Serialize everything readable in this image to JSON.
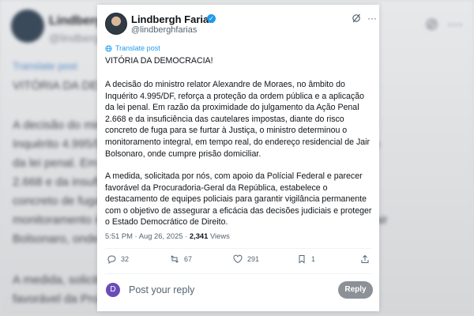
{
  "author": {
    "display_name": "Lindbergh Farias",
    "handle": "@lindberghfarias",
    "verified": true
  },
  "translate_label": "Translate post",
  "post": {
    "headline": "VITÓRIA DA DEMOCRACIA!",
    "paragraph_1": "A decisão do ministro relator Alexandre de Moraes, no âmbito do Inquérito 4.995/DF, reforça a proteção da ordem pública e a aplicação da lei penal. Em razão da proximidade do julgamento da Ação Penal 2.668 e da insuficiência das cautelares impostas, diante do risco concreto de fuga para se furtar à Justiça, o ministro determinou o monitoramento integral, em tempo real, do endereço residencial de Jair Bolsonaro, onde cumpre prisão domiciliar.",
    "paragraph_2": "A medida, solicitada por nós, com apoio da Polícial Federal e parecer favorável da Procuradoria-Geral da República, estabelece o destacamento de equipes policiais para garantir vigilância permanente com o objetivo de assegurar a eficácia das decisões judiciais e proteger o Estado Democrático de Direito."
  },
  "meta": {
    "time": "5:51 PM",
    "date": "Aug 26, 2025",
    "views": "2,341",
    "views_label": "Views"
  },
  "actions": {
    "replies": "32",
    "reposts": "67",
    "likes": "291",
    "bookmarks": "1"
  },
  "reply_box": {
    "avatar_letter": "D",
    "placeholder": "Post your reply",
    "button_label": "Reply"
  },
  "colors": {
    "accent": "#1d9bf0",
    "muted": "#536471",
    "reply_avatar": "#6c4bb8",
    "reply_button": "#8b9196"
  }
}
